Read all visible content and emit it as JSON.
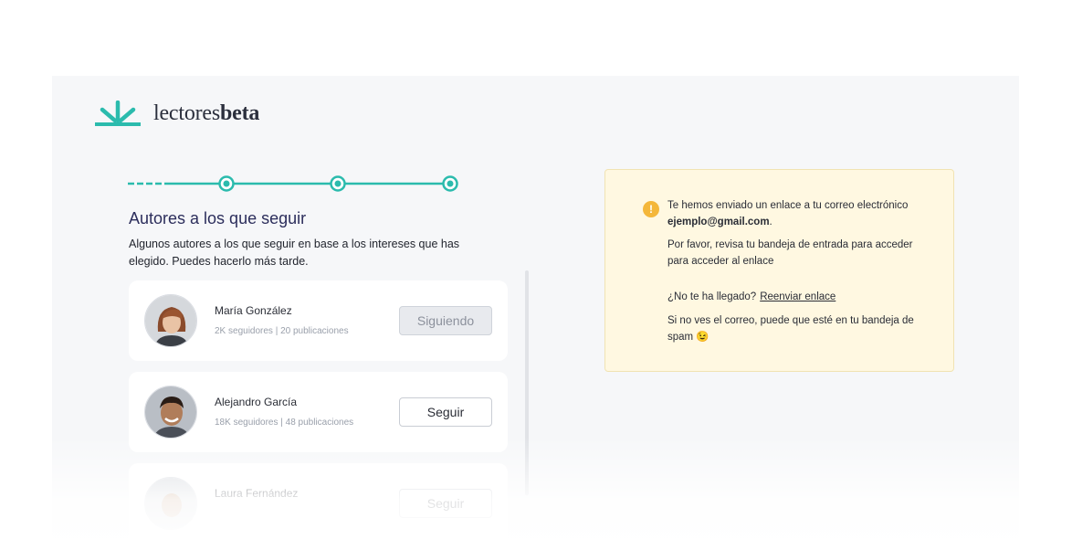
{
  "brand": {
    "name_light": "lectores",
    "name_bold": "beta",
    "accent": "#2bbbad",
    "logo_icon": "sunrise-logo-icon"
  },
  "stepper": {
    "total_steps": 4,
    "current_step": 1
  },
  "page": {
    "title": "Autores a los que seguir",
    "subtitle": "Algunos autores a los que seguir en base a los intereses que has elegido. Puedes hacerlo más tarde."
  },
  "authors": [
    {
      "name": "María González",
      "meta": "2K seguidores | 20 publicaciones",
      "button": "Siguiendo",
      "following": true
    },
    {
      "name": "Alejandro García",
      "meta": "18K seguidores | 48 publicaciones",
      "button": "Seguir",
      "following": false
    },
    {
      "name": "Laura Fernández",
      "meta": "",
      "button": "Seguir",
      "following": false
    }
  ],
  "notice": {
    "icon": "warning-icon",
    "icon_glyph": "!",
    "sent_text": "Te hemos enviado un enlace a tu correo electrónico",
    "email": "ejemplo@gmail.com",
    "email_suffix": ".",
    "check_inbox": "Por favor, revisa tu bandeja de entrada para acceder para acceder al enlace",
    "not_arrived": "¿No te ha llegado?",
    "resend_label": "Reenviar enlace",
    "spam_text": "Si no ves el correo, puede que esté en tu bandeja de spam",
    "spam_emoji": "😉",
    "background": "#fff8e1",
    "icon_color": "#f4b73a"
  }
}
